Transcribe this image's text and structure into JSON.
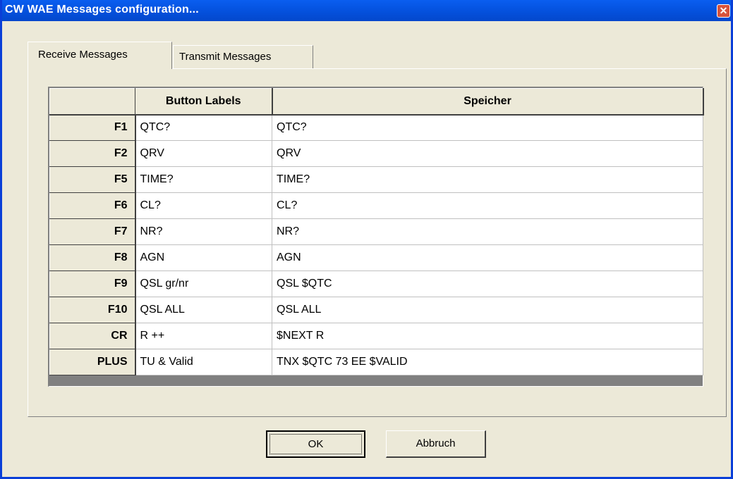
{
  "window": {
    "title": "CW WAE Messages configuration...",
    "close_glyph": "✕"
  },
  "tabs": [
    {
      "label": "Receive Messages",
      "active": true
    },
    {
      "label": "Transmit Messages",
      "active": false
    }
  ],
  "grid": {
    "headers": [
      "",
      "Button Labels",
      "Speicher"
    ],
    "rows": [
      {
        "key": "F1",
        "label": "QTC?",
        "memory": "QTC?"
      },
      {
        "key": "F2",
        "label": "QRV",
        "memory": "QRV"
      },
      {
        "key": "F5",
        "label": "TIME?",
        "memory": "TIME?"
      },
      {
        "key": "F6",
        "label": "CL?",
        "memory": "CL?"
      },
      {
        "key": "F7",
        "label": "NR?",
        "memory": "NR?"
      },
      {
        "key": "F8",
        "label": "AGN",
        "memory": "AGN"
      },
      {
        "key": "F9",
        "label": "QSL gr/nr",
        "memory": "QSL $QTC"
      },
      {
        "key": "F10",
        "label": "QSL ALL",
        "memory": "QSL ALL"
      },
      {
        "key": "CR",
        "label": "R ++",
        "memory": "$NEXT R"
      },
      {
        "key": "PLUS",
        "label": "TU & Valid",
        "memory": "TNX $QTC 73 EE $VALID"
      }
    ]
  },
  "buttons": {
    "ok": "OK",
    "cancel": "Abbruch"
  },
  "colors": {
    "titlebar": "#0553e0",
    "face": "#ece9d8",
    "close": "#d9533b"
  }
}
